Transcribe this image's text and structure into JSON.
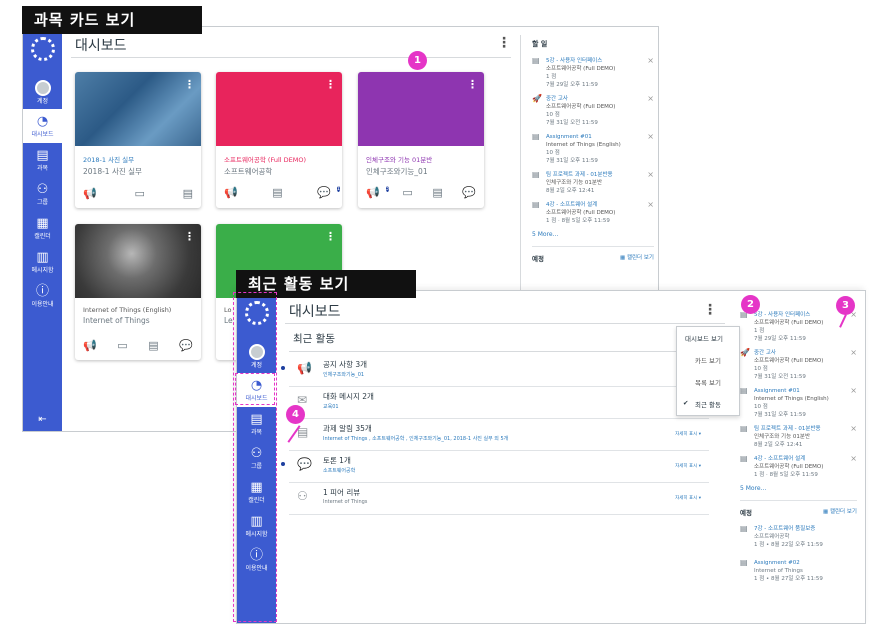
{
  "labels": {
    "card_view": "과목 카드 보기",
    "activity_view": "최근 활동 보기"
  },
  "nav": {
    "account": "계정",
    "dashboard": "대시보드",
    "courses": "과목",
    "groups": "그룹",
    "calendar": "캘린더",
    "inbox": "메시지함",
    "help": "이용안내"
  },
  "dashboard": {
    "title": "대시보드",
    "cards": [
      {
        "title": "2018-1 사진 실무",
        "subtitle": "2018-1 사진 실무",
        "color": "#2b6fa3",
        "title_color": "#2b7abc"
      },
      {
        "title": "소프트웨어공학 (Full DEMO)",
        "subtitle": "소프트웨어공학",
        "color": "#e8245c",
        "title_color": "#e8245c",
        "badge": "1"
      },
      {
        "title": "인체구조와 기능 01분반",
        "subtitle": "인체구조와기능_01",
        "color": "#8e35b0",
        "title_color": "#8e35b0",
        "badge": "3"
      },
      {
        "title": "Internet of Things (English)",
        "subtitle": "Internet of Things",
        "color": "#555555",
        "title_color": "#555555"
      },
      {
        "title": "Lo",
        "subtitle": "Le",
        "color": "#3aae49",
        "title_color": "#555555"
      }
    ]
  },
  "todo": {
    "title": "할 일",
    "items": [
      {
        "title": "5강 - 사용자 인터페이스",
        "course": "소프트웨어공학 (Full DEMO)",
        "points": "1 점",
        "date": "7월 29일 오후 11:59"
      },
      {
        "title": "중간 고사",
        "course": "소프트웨어공학 (Full DEMO)",
        "points": "10 점",
        "date": "7월 31일 오전 11:59"
      },
      {
        "title": "Assignment #01",
        "course": "Internet of Things (English)",
        "points": "10 점",
        "date": "7월 31일 오후 11:59"
      },
      {
        "title": "팀 프로젝트 과제 - 01분반용",
        "course": "인체구조와 기능 01분반",
        "points": "",
        "date": "8월 2일 오후 12:41"
      },
      {
        "title": "4강 - 소프트웨어 설계",
        "course": "소프트웨어공학 (Full DEMO)",
        "points": "1 점",
        "date": "8월 5일 오후 11:59"
      }
    ],
    "more": "5 More...",
    "upcoming_title": "예정",
    "calendar_link": "캘린더 보기",
    "upcoming": [
      {
        "title": "7강 - 소프트웨어 품질보증",
        "course": "소프트웨어공학",
        "date": "1 점 • 8월 22일 오후 11:59"
      },
      {
        "title": "Assignment #02",
        "course": "Internet of Things",
        "date": "1 점 • 8월 27일 오후 11:59"
      }
    ]
  },
  "activity": {
    "title": "최근 활동",
    "rows": [
      {
        "title": "공지 사항 3개",
        "sub": "인체구조와기능_01",
        "toggle": "자세히 표시",
        "unread": true
      },
      {
        "title": "대화 메시지 2개",
        "sub": "교육01",
        "toggle": "자세히 표시",
        "unread": false
      },
      {
        "title": "과제 알림 35개",
        "sub": "Internet of Things , 소프트웨어공학 , 인체구조와기능_01, 2018-1 사진 실무 외 5개",
        "toggle": "자세히 표시",
        "unread": false
      },
      {
        "title": "토론 1개",
        "sub": "소프트웨어공학",
        "toggle": "자세히 표시",
        "unread": true
      },
      {
        "title": "1 피어 리뷰",
        "sub": "Internet of Things",
        "toggle": "자세히 표시",
        "unread": false
      }
    ]
  },
  "view_menu": {
    "options": [
      "대시보드 보기",
      "카드 보기",
      "목록 보기",
      "최근 활동"
    ]
  },
  "callouts": [
    "1",
    "2",
    "3",
    "4"
  ]
}
